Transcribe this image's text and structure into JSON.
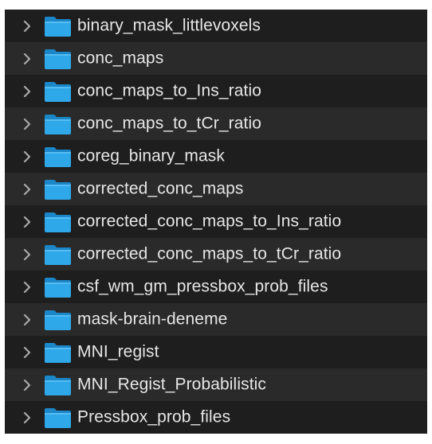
{
  "folders": [
    {
      "name": "binary_mask_littlevoxels",
      "icon": "folder-icon",
      "disclosure": "chevron-right-icon"
    },
    {
      "name": "conc_maps",
      "icon": "folder-icon",
      "disclosure": "chevron-right-icon"
    },
    {
      "name": "conc_maps_to_Ins_ratio",
      "icon": "folder-icon",
      "disclosure": "chevron-right-icon"
    },
    {
      "name": "conc_maps_to_tCr_ratio",
      "icon": "folder-icon",
      "disclosure": "chevron-right-icon"
    },
    {
      "name": "coreg_binary_mask",
      "icon": "folder-icon",
      "disclosure": "chevron-right-icon"
    },
    {
      "name": "corrected_conc_maps",
      "icon": "folder-icon",
      "disclosure": "chevron-right-icon"
    },
    {
      "name": "corrected_conc_maps_to_Ins_ratio",
      "icon": "folder-icon",
      "disclosure": "chevron-right-icon"
    },
    {
      "name": "corrected_conc_maps_to_tCr_ratio",
      "icon": "folder-icon",
      "disclosure": "chevron-right-icon"
    },
    {
      "name": "csf_wm_gm_pressbox_prob_files",
      "icon": "folder-icon",
      "disclosure": "chevron-right-icon"
    },
    {
      "name": "mask-brain-deneme",
      "icon": "folder-icon",
      "disclosure": "chevron-right-icon"
    },
    {
      "name": "MNI_regist",
      "icon": "folder-icon",
      "disclosure": "chevron-right-icon"
    },
    {
      "name": "MNI_Regist_Probabilistic",
      "icon": "folder-icon",
      "disclosure": "chevron-right-icon"
    },
    {
      "name": "Pressbox_prob_files",
      "icon": "folder-icon",
      "disclosure": "chevron-right-icon"
    }
  ],
  "colors": {
    "background": "#1e1e1e",
    "stripe": "#2a2a2a",
    "text": "#e6e6e6",
    "chevron": "#a8a8a8",
    "folder_front": "#2fa8ea",
    "folder_back": "#1b86c8"
  }
}
